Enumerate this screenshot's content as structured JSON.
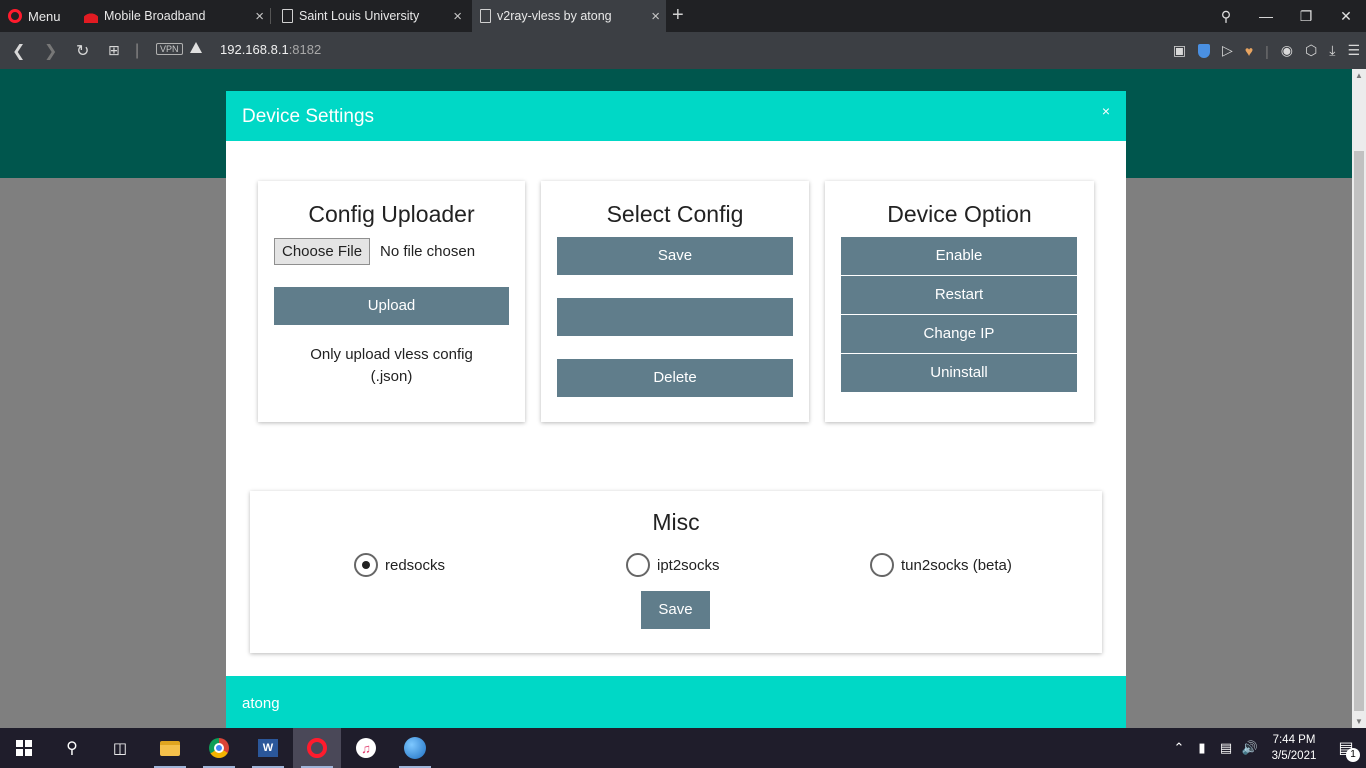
{
  "browser": {
    "menu_label": "Menu",
    "tabs": [
      {
        "title": "Mobile Broadband"
      },
      {
        "title": "Saint Louis University"
      },
      {
        "title": "v2ray-vless by atong"
      }
    ],
    "vpn_label": "VPN",
    "url_host": "192.168.8.1",
    "url_port": ":8182"
  },
  "modal": {
    "title": "Device Settings",
    "close_glyph": "×",
    "config_uploader": {
      "title": "Config Uploader",
      "choose_file_label": "Choose File",
      "no_file_text": "No file chosen",
      "upload_label": "Upload",
      "note_line1": "Only upload vless config",
      "note_line2": "(.json)"
    },
    "select_config": {
      "title": "Select Config",
      "save_label": "Save",
      "selected_value": "",
      "delete_label": "Delete"
    },
    "device_option": {
      "title": "Device Option",
      "enable_label": "Enable",
      "restart_label": "Restart",
      "change_ip_label": "Change IP",
      "uninstall_label": "Uninstall"
    },
    "misc": {
      "title": "Misc",
      "options": [
        {
          "label": "redsocks",
          "checked": true
        },
        {
          "label": "ipt2socks",
          "checked": false
        },
        {
          "label": "tun2socks (beta)",
          "checked": false
        }
      ],
      "save_label": "Save"
    },
    "footer_text": "atong"
  },
  "taskbar": {
    "time": "7:44 PM",
    "date": "3/5/2021",
    "notification_count": "1"
  }
}
